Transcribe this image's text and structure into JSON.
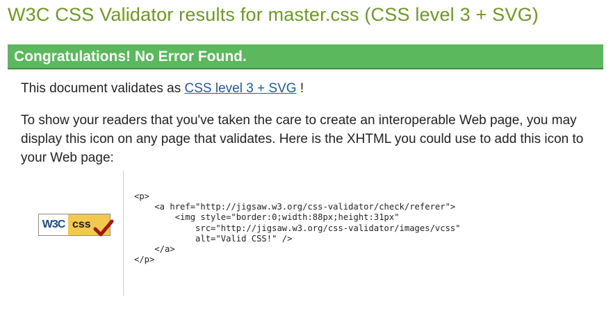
{
  "page": {
    "title": "W3C CSS Validator results for master.css (CSS level 3 + SVG)"
  },
  "banner": {
    "message": "Congratulations! No Error Found."
  },
  "validation": {
    "prefix": "This document validates as",
    "link_label": "CSS level 3 + SVG",
    "suffix": " !"
  },
  "explanation": {
    "text": "To show your readers that you've taken the care to create an interoperable Web page, you may display this icon on any page that validates. Here is the XHTML you could use to add this icon to your Web page:"
  },
  "badge": {
    "w3c_text": "W3C",
    "css_text": "css",
    "icon": "valid-css-badge-icon",
    "accent_color": "#f2c94c",
    "check_color": "#a31515"
  },
  "code_snippet": {
    "lines": [
      "<p>",
      "    <a href=\"http://jigsaw.w3.org/css-validator/check/referer\">",
      "        <img style=\"border:0;width:88px;height:31px\"",
      "            src=\"http://jigsaw.w3.org/css-validator/images/vcss\"",
      "            alt=\"Valid CSS!\" />",
      "    </a>",
      "</p>"
    ]
  },
  "colors": {
    "title": "#6b9a1f",
    "banner_bg": "#5cb85c",
    "link": "#1f5aa3"
  }
}
